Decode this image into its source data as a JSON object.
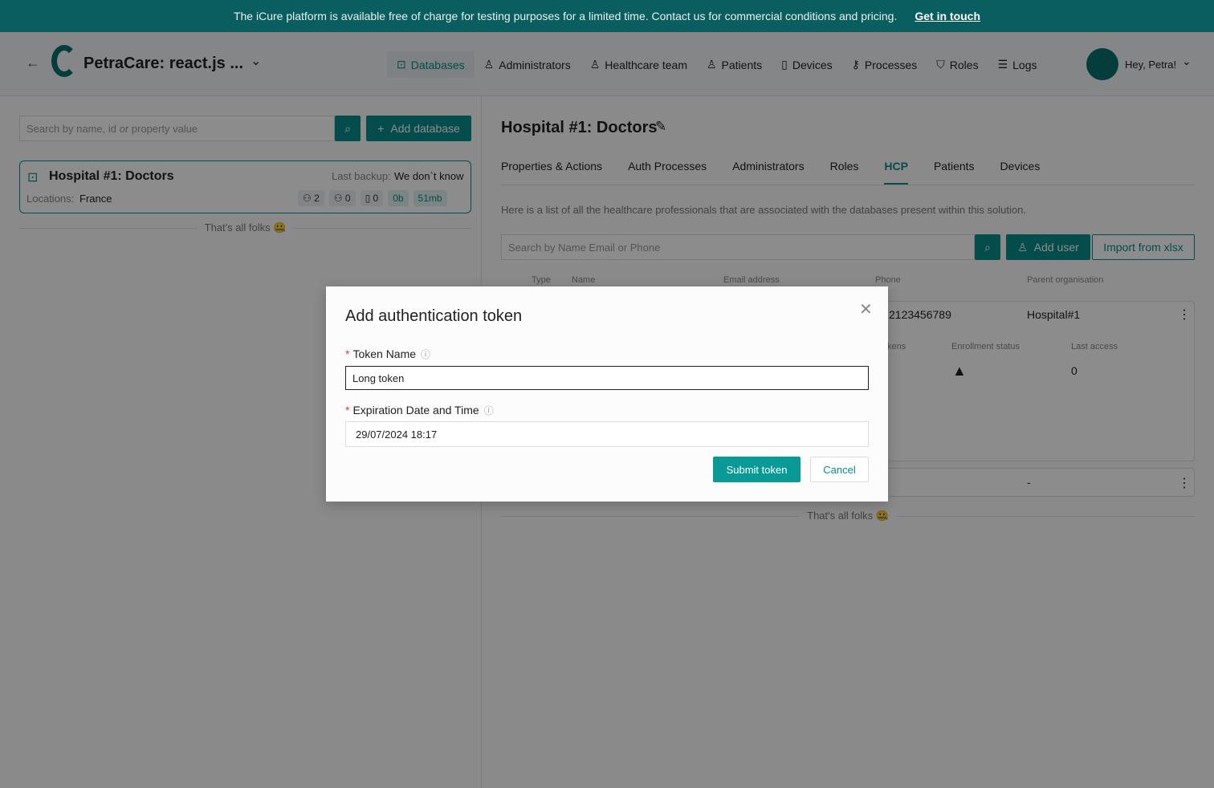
{
  "banner": {
    "text": "The iCure platform is available free of charge for testing purposes for a limited time. Contact us for commercial conditions and pricing.",
    "link": "Get in touch"
  },
  "header": {
    "app_title": "PetraCare: react.js ...",
    "nav": [
      {
        "label": "Databases",
        "icon": "database-icon",
        "active": true
      },
      {
        "label": "Administrators",
        "icon": "admin-icon"
      },
      {
        "label": "Healthcare team",
        "icon": "doctor-icon"
      },
      {
        "label": "Patients",
        "icon": "person-icon"
      },
      {
        "label": "Devices",
        "icon": "device-icon"
      },
      {
        "label": "Processes",
        "icon": "key-icon"
      },
      {
        "label": "Roles",
        "icon": "shield-icon"
      },
      {
        "label": "Logs",
        "icon": "list-icon"
      }
    ],
    "greeting": "Hey, Petra!"
  },
  "left": {
    "search_placeholder": "Search by name, id or property value",
    "add_database": "Add database",
    "card": {
      "title": "Hospital #1: Doctors",
      "last_backup_label": "Last backup:",
      "last_backup": "We don`t know",
      "locations_label": "Locations:",
      "locations": "France",
      "hcp_count": "2",
      "patient_count": "0",
      "device_count": "0",
      "size1": "0b",
      "size2": "51mb"
    },
    "end_text": "That's all folks 🤐"
  },
  "main": {
    "title": "Hospital #1: Doctors",
    "tabs": [
      "Properties & Actions",
      "Auth Processes",
      "Administrators",
      "Roles",
      "HCP",
      "Patients",
      "Devices"
    ],
    "active_tab": "HCP",
    "description": "Here is a list of all the healthcare professionals that are associated with the databases present within this solution.",
    "search_placeholder": "Search by Name Email or Phone",
    "add_user": "Add user",
    "import": "Import from xlsx",
    "columns": [
      "Type",
      "Name",
      "Email address",
      "Phone",
      "Parent organisation"
    ],
    "row1": {
      "phone": "2123456789",
      "parent": "Hospital#1",
      "sub_columns": [
        "kens",
        "Enrollment status",
        "Last access"
      ],
      "last_access": "0"
    },
    "row2": {
      "parent": "-"
    },
    "end_text": "That's all folks 🤐"
  },
  "modal": {
    "title": "Add authentication token",
    "token_label": "Token Name",
    "token_value": "Long token",
    "exp_label": "Expiration Date and Time",
    "exp_value": "29/07/2024 18:17",
    "submit": "Submit token",
    "cancel": "Cancel"
  },
  "colors": {
    "accent": "#0a8a8a",
    "banner": "#0b5e5f"
  }
}
